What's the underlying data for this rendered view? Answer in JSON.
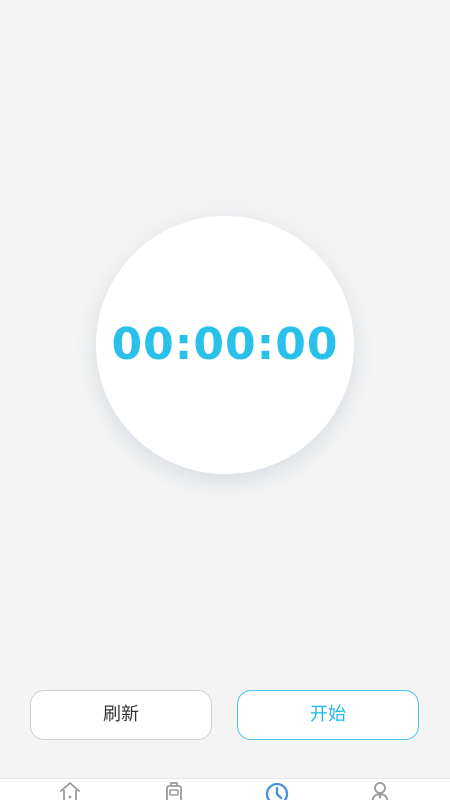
{
  "timer": {
    "display": "00:00:00"
  },
  "actions": {
    "refresh_label": "刷新",
    "start_label": "开始"
  },
  "bottom_nav": {
    "items": [
      {
        "icon": "home-icon",
        "active": false
      },
      {
        "icon": "bag-icon",
        "active": false
      },
      {
        "icon": "clock-icon",
        "active": true
      },
      {
        "icon": "user-icon",
        "active": false
      }
    ]
  },
  "colors": {
    "background": "#f4f4f4",
    "surface": "#ffffff",
    "accent": "#29c1ea",
    "button_border": "#cfcfcf",
    "nav_inactive": "#9a9a9a",
    "nav_active": "#4a90e2"
  }
}
